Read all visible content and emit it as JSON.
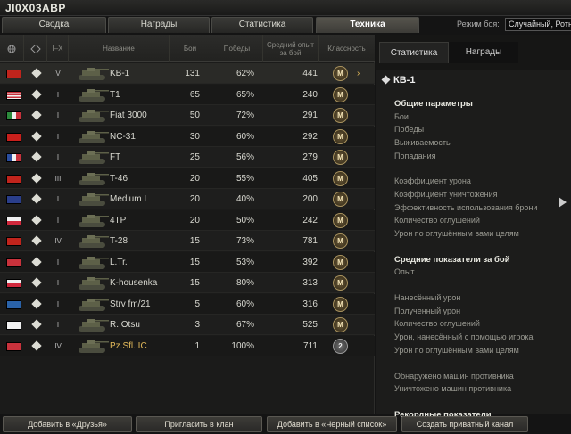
{
  "window": {
    "title": "JI0X03ABP"
  },
  "tabs": [
    {
      "label": "Сводка"
    },
    {
      "label": "Награды"
    },
    {
      "label": "Статистика"
    },
    {
      "label": "Техника"
    }
  ],
  "battle_mode": {
    "label": "Режим боя:",
    "value": "Случайный, Ротн"
  },
  "table": {
    "headers": {
      "tier": "I–X",
      "name": "Название",
      "battles": "Бои",
      "wins": "Победы",
      "avg_exp": "Средний опыт за бой",
      "mastery": "Классность"
    },
    "rows": [
      {
        "flag": "ussr",
        "tier": "V",
        "name": "KB-1",
        "battles": "131",
        "wins": "62%",
        "exp": "441",
        "mastery": "M",
        "premium": false,
        "selected": true
      },
      {
        "flag": "usa",
        "tier": "I",
        "name": "T1",
        "battles": "65",
        "wins": "65%",
        "exp": "240",
        "mastery": "M",
        "premium": false
      },
      {
        "flag": "italy",
        "tier": "I",
        "name": "Fiat 3000",
        "battles": "50",
        "wins": "72%",
        "exp": "291",
        "mastery": "M",
        "premium": false
      },
      {
        "flag": "china",
        "tier": "I",
        "name": "NC-31",
        "battles": "30",
        "wins": "60%",
        "exp": "292",
        "mastery": "M",
        "premium": false
      },
      {
        "flag": "france",
        "tier": "I",
        "name": "FT",
        "battles": "25",
        "wins": "56%",
        "exp": "279",
        "mastery": "M",
        "premium": false
      },
      {
        "flag": "ussr",
        "tier": "III",
        "name": "T-46",
        "battles": "20",
        "wins": "55%",
        "exp": "405",
        "mastery": "M",
        "premium": false
      },
      {
        "flag": "uk",
        "tier": "I",
        "name": "Medium I",
        "battles": "20",
        "wins": "40%",
        "exp": "200",
        "mastery": "M",
        "premium": false
      },
      {
        "flag": "poland",
        "tier": "I",
        "name": "4TP",
        "battles": "20",
        "wins": "50%",
        "exp": "242",
        "mastery": "M",
        "premium": false
      },
      {
        "flag": "ussr",
        "tier": "IV",
        "name": "T-28",
        "battles": "15",
        "wins": "73%",
        "exp": "781",
        "mastery": "M",
        "premium": false
      },
      {
        "flag": "germany",
        "tier": "I",
        "name": "L.Tr.",
        "battles": "15",
        "wins": "53%",
        "exp": "392",
        "mastery": "M",
        "premium": false
      },
      {
        "flag": "czech",
        "tier": "I",
        "name": "K-housenka",
        "battles": "15",
        "wins": "80%",
        "exp": "313",
        "mastery": "M",
        "premium": false
      },
      {
        "flag": "sweden",
        "tier": "I",
        "name": "Strv fm/21",
        "battles": "5",
        "wins": "60%",
        "exp": "316",
        "mastery": "M",
        "premium": false
      },
      {
        "flag": "japan",
        "tier": "I",
        "name": "R. Otsu",
        "battles": "3",
        "wins": "67%",
        "exp": "525",
        "mastery": "M",
        "premium": false
      },
      {
        "flag": "germany",
        "tier": "IV",
        "name": "Pz.Sfl. IC",
        "battles": "1",
        "wins": "100%",
        "exp": "711",
        "mastery": "2",
        "premium": true
      }
    ]
  },
  "right_panel": {
    "tabs": [
      {
        "label": "Статистика"
      },
      {
        "label": "Награды"
      }
    ],
    "vehicle_title": "КВ-1",
    "sections": [
      {
        "heading": "Общие параметры",
        "lines": [
          "Бои",
          "Победы",
          "Выживаемость",
          "Попадания"
        ]
      },
      {
        "heading": "",
        "lines": [
          "Коэффициент урона",
          "Коэффициент уничтожения",
          "Эффективность использования брони",
          "Количество оглушений",
          "Урон по оглушённым вами целям"
        ]
      },
      {
        "heading": "Средние показатели за бой",
        "lines": [
          "Опыт"
        ]
      },
      {
        "heading": "",
        "lines": [
          "Нанесённый урон",
          "Полученный урон",
          "Количество оглушений",
          "Урон, нанесённый с помощью игрока",
          "Урон по оглушённым вами целям"
        ]
      },
      {
        "heading": "",
        "lines": [
          "Обнаружено машин противника",
          "Уничтожено машин противника"
        ]
      },
      {
        "heading": "Рекордные показатели",
        "lines": []
      }
    ]
  },
  "buttons": {
    "add_friend": "Добавить в «Друзья»",
    "invite_clan": "Пригласить в клан",
    "add_blacklist": "Добавить в «Черный список»",
    "private_channel": "Создать приватный канал"
  }
}
